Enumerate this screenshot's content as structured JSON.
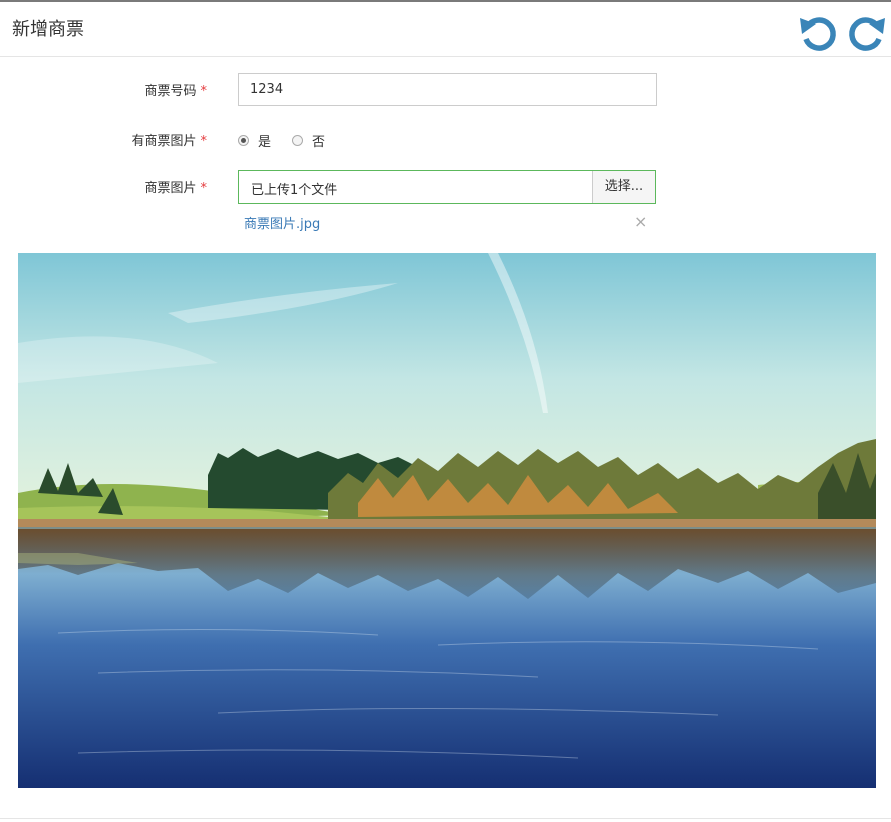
{
  "header": {
    "title": "新增商票",
    "undo_icon": "undo-icon",
    "redo_icon": "redo-icon",
    "icon_color": "#3a85b8"
  },
  "form": {
    "ticket_number": {
      "label": "商票号码",
      "required_mark": "*",
      "value": "1234"
    },
    "has_image": {
      "label": "有商票图片",
      "required_mark": "*",
      "options": [
        {
          "label": "是",
          "checked": true
        },
        {
          "label": "否",
          "checked": false
        }
      ]
    },
    "image": {
      "label": "商票图片",
      "required_mark": "*",
      "status_text": "已上传1个文件",
      "choose_label": "选择...",
      "file_name": "商票图片.jpg",
      "remove_icon": "×"
    }
  },
  "preview": {
    "image": "lake-landscape-photo"
  },
  "colors": {
    "required": "#e4393c",
    "accent_border": "#5cb85c",
    "link": "#3a7ab6"
  }
}
